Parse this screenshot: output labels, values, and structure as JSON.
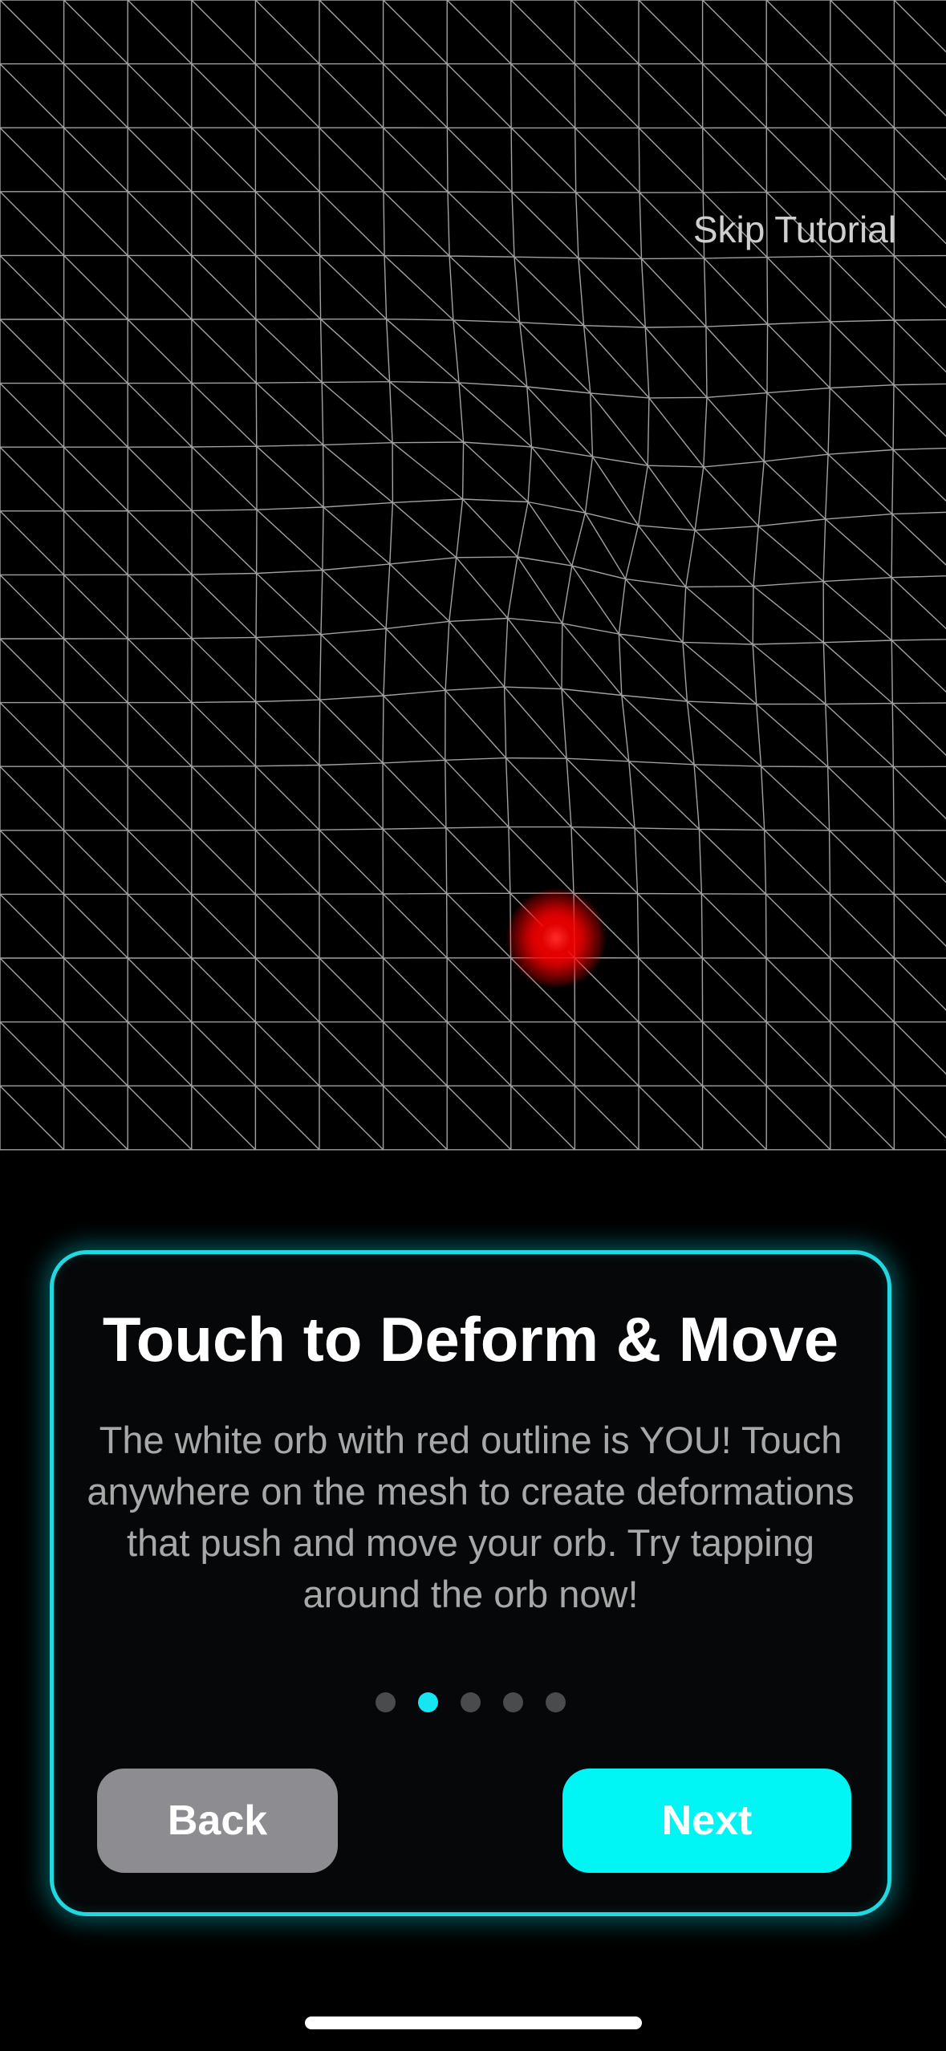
{
  "skip_tutorial_label": "Skip Tutorial",
  "card": {
    "title": "Touch to Deform & Move",
    "body": "The white orb with red outline is YOU! Touch anywhere on the mesh to create deformations that push and move your orb. Try tapping around the orb now!",
    "page_count": 5,
    "active_page_index": 1,
    "back_label": "Back",
    "next_label": "Next"
  },
  "colors": {
    "background": "#000000",
    "accent": "#00f5f5",
    "mesh_line": "#bdbdbd",
    "orb": "#ff0000",
    "back_button": "#8d8d91"
  }
}
